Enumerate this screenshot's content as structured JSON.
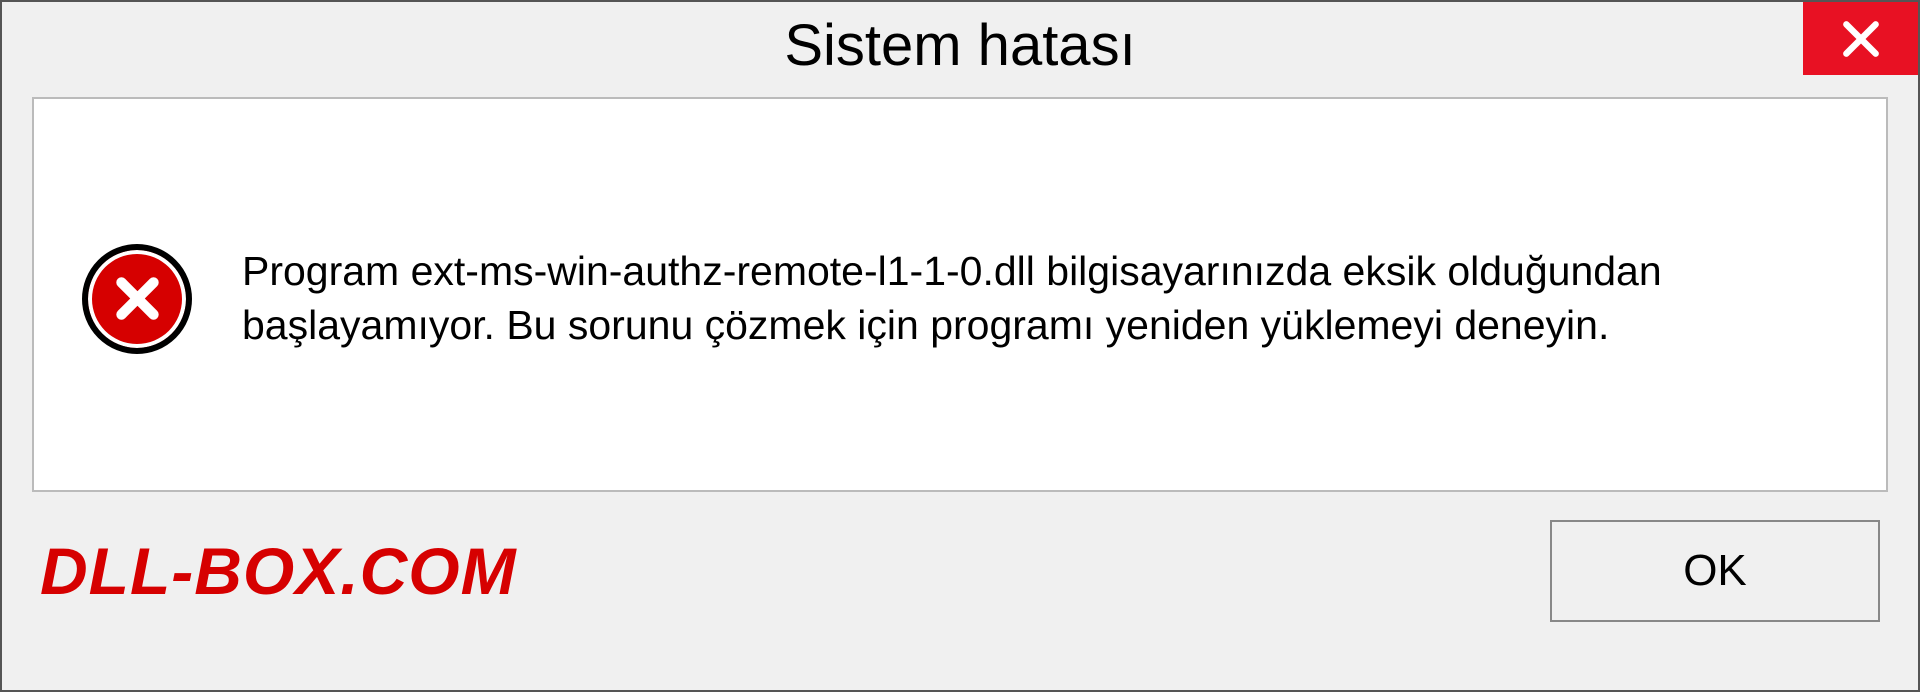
{
  "dialog": {
    "title": "Sistem hatası",
    "message": "Program ext-ms-win-authz-remote-l1-1-0.dll bilgisayarınızda eksik olduğundan başlayamıyor. Bu sorunu çözmek için programı yeniden yüklemeyi deneyin.",
    "ok_label": "OK"
  },
  "watermark": "DLL-BOX.COM"
}
